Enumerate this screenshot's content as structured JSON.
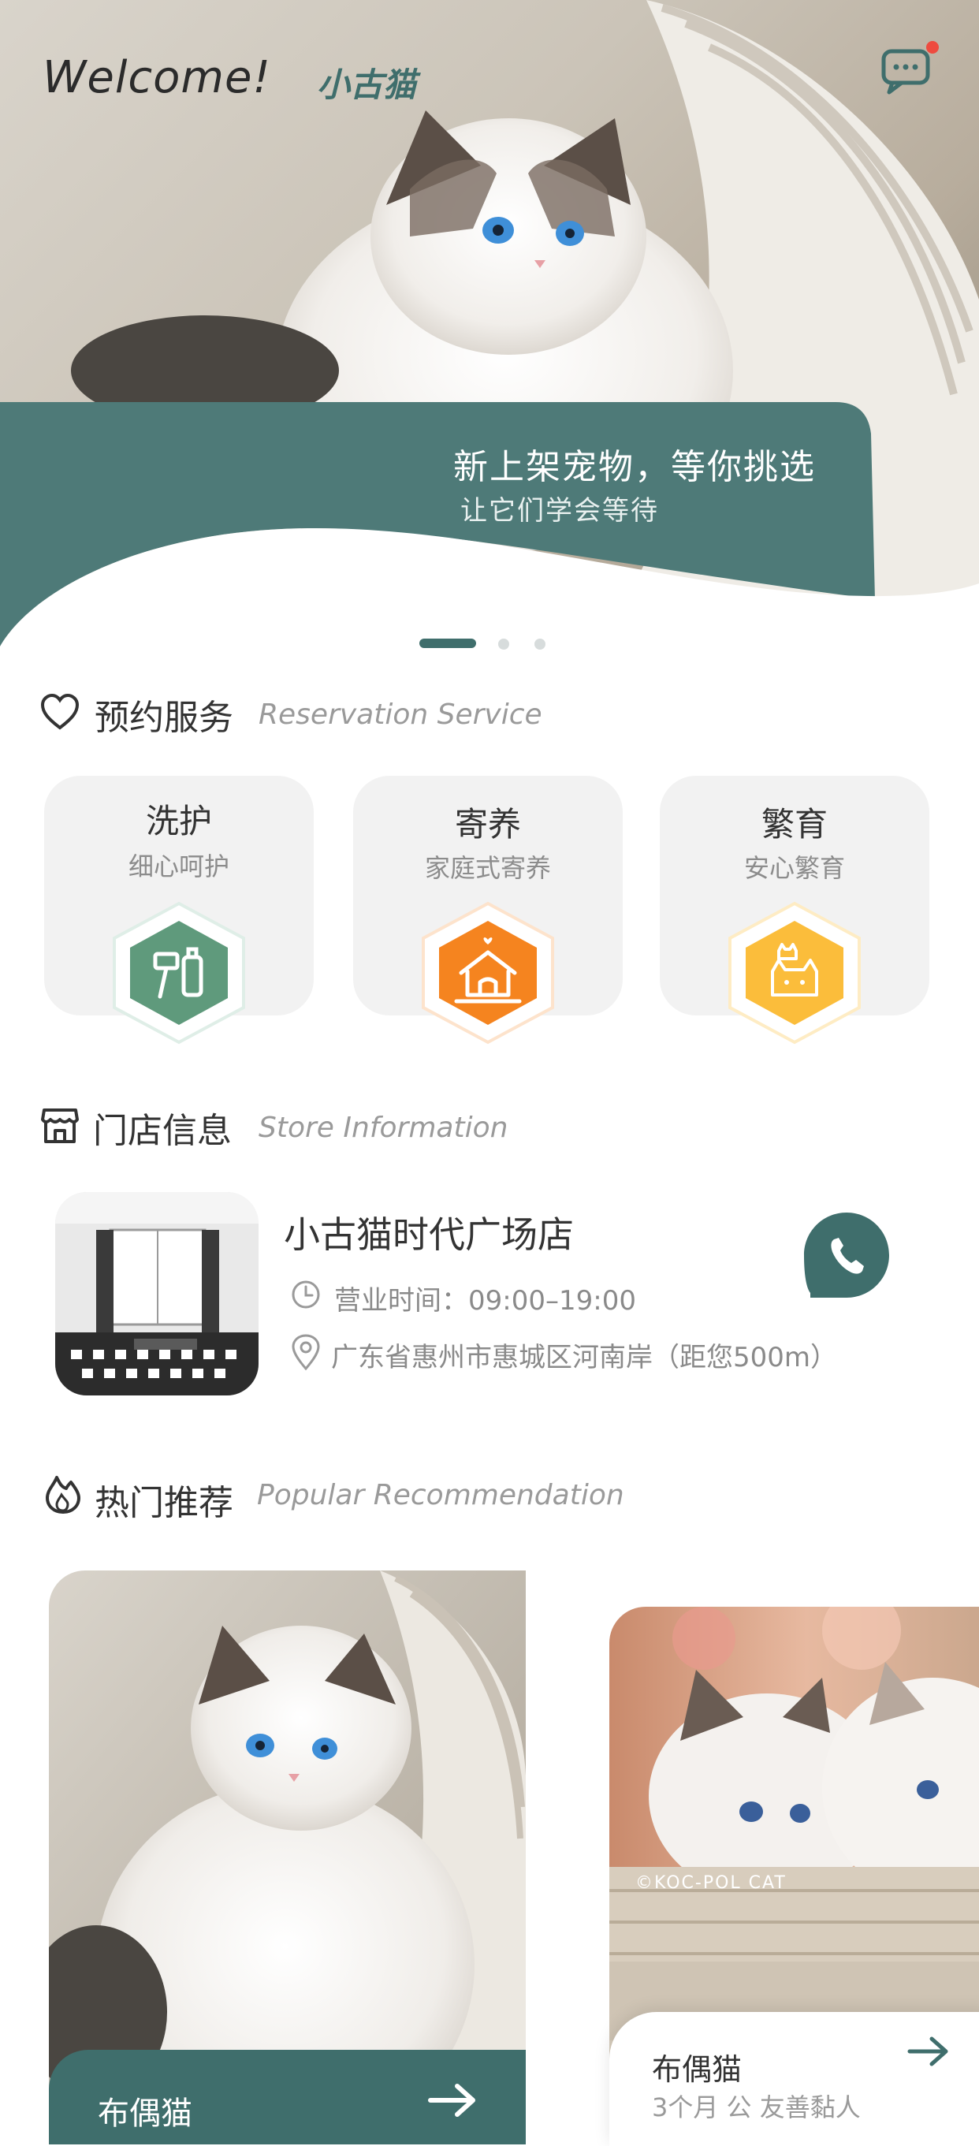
{
  "header": {
    "welcome": "Welcome!",
    "brand": "小古猫",
    "message_icon": "chat-bubble-icon",
    "has_unread": true
  },
  "banner": {
    "title": "新上架宠物，等你挑选",
    "subtitle": "让它们学会等待",
    "page_count": 3,
    "active_page": 1
  },
  "reservation": {
    "title_cn": "预约服务",
    "title_en": "Reservation Service",
    "icon": "heart-outline-icon",
    "services": [
      {
        "title": "洗护",
        "subtitle": "细心呵护",
        "icon": "grooming-tools-icon",
        "color": "#5f9a7c"
      },
      {
        "title": "寄养",
        "subtitle": "家庭式寄养",
        "icon": "pet-house-icon",
        "color": "#f5841f"
      },
      {
        "title": "繁育",
        "subtitle": "安心繁育",
        "icon": "cat-family-icon",
        "color": "#fbbd3b"
      }
    ]
  },
  "store": {
    "title_cn": "门店信息",
    "title_en": "Store Information",
    "icon": "storefront-icon",
    "name": "小古猫时代广场店",
    "hours": "营业时间：09:00–19:00",
    "address": "广东省惠州市惠城区河南岸（距您500m）",
    "call_icon": "phone-icon"
  },
  "recommend": {
    "title_cn": "热门推荐",
    "title_en": "Popular Recommendation",
    "icon": "flame-icon",
    "items": [
      {
        "name": "布偶猫",
        "tags": ""
      },
      {
        "name": "布偶猫",
        "tags": "3个月 公 友善黏人",
        "watermark": "©KOC-POL CAT"
      }
    ]
  },
  "colors": {
    "accent": "#3f6e6c",
    "card_bg": "#f2f2f2"
  }
}
